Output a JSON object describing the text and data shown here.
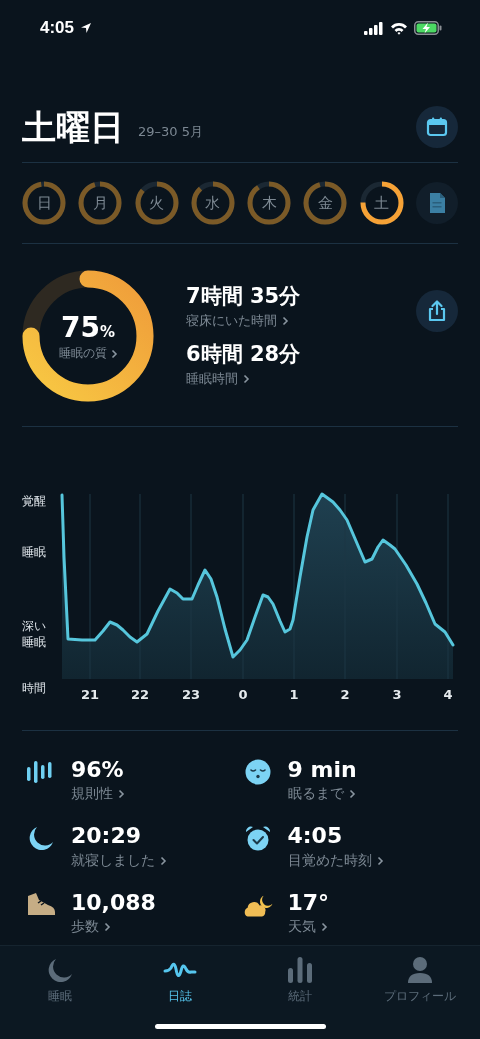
{
  "status_bar": {
    "time": "4:05"
  },
  "header": {
    "title": "土曜日",
    "date": "29–30 5月"
  },
  "days": [
    {
      "label": "日",
      "selected": false
    },
    {
      "label": "月",
      "selected": false
    },
    {
      "label": "火",
      "selected": false
    },
    {
      "label": "水",
      "selected": false
    },
    {
      "label": "木",
      "selected": false
    },
    {
      "label": "金",
      "selected": false
    },
    {
      "label": "土",
      "selected": true
    }
  ],
  "quality": {
    "value": "75",
    "unit": "%",
    "label": "睡眠の質"
  },
  "durations": [
    {
      "value": "7時間 35分",
      "label": "寝床にいた時間"
    },
    {
      "value": "6時間 28分",
      "label": "睡眠時間"
    }
  ],
  "chart": {
    "y_labels": [
      "覚醒",
      "睡眠",
      "深い睡眠"
    ],
    "x_label": "時間",
    "x_ticks": [
      "21",
      "22",
      "23",
      "0",
      "1",
      "2",
      "3",
      "4"
    ]
  },
  "stats": [
    {
      "kind": "regularity",
      "value": "96%",
      "label": "規則性"
    },
    {
      "kind": "latency",
      "value": "9 min",
      "label": "眠るまで"
    },
    {
      "kind": "bedtime",
      "value": "20:29",
      "label": "就寝しました"
    },
    {
      "kind": "wake",
      "value": "4:05",
      "label": "目覚めた時刻"
    },
    {
      "kind": "steps",
      "value": "10,088",
      "label": "歩数"
    },
    {
      "kind": "weather",
      "value": "17°",
      "label": "天気"
    }
  ],
  "tabs": [
    {
      "kind": "sleep",
      "label": "睡眠",
      "selected": false
    },
    {
      "kind": "journal",
      "label": "日誌",
      "selected": true
    },
    {
      "kind": "stats",
      "label": "統計",
      "selected": false
    },
    {
      "kind": "profile",
      "label": "プロフィール",
      "selected": false
    }
  ]
}
